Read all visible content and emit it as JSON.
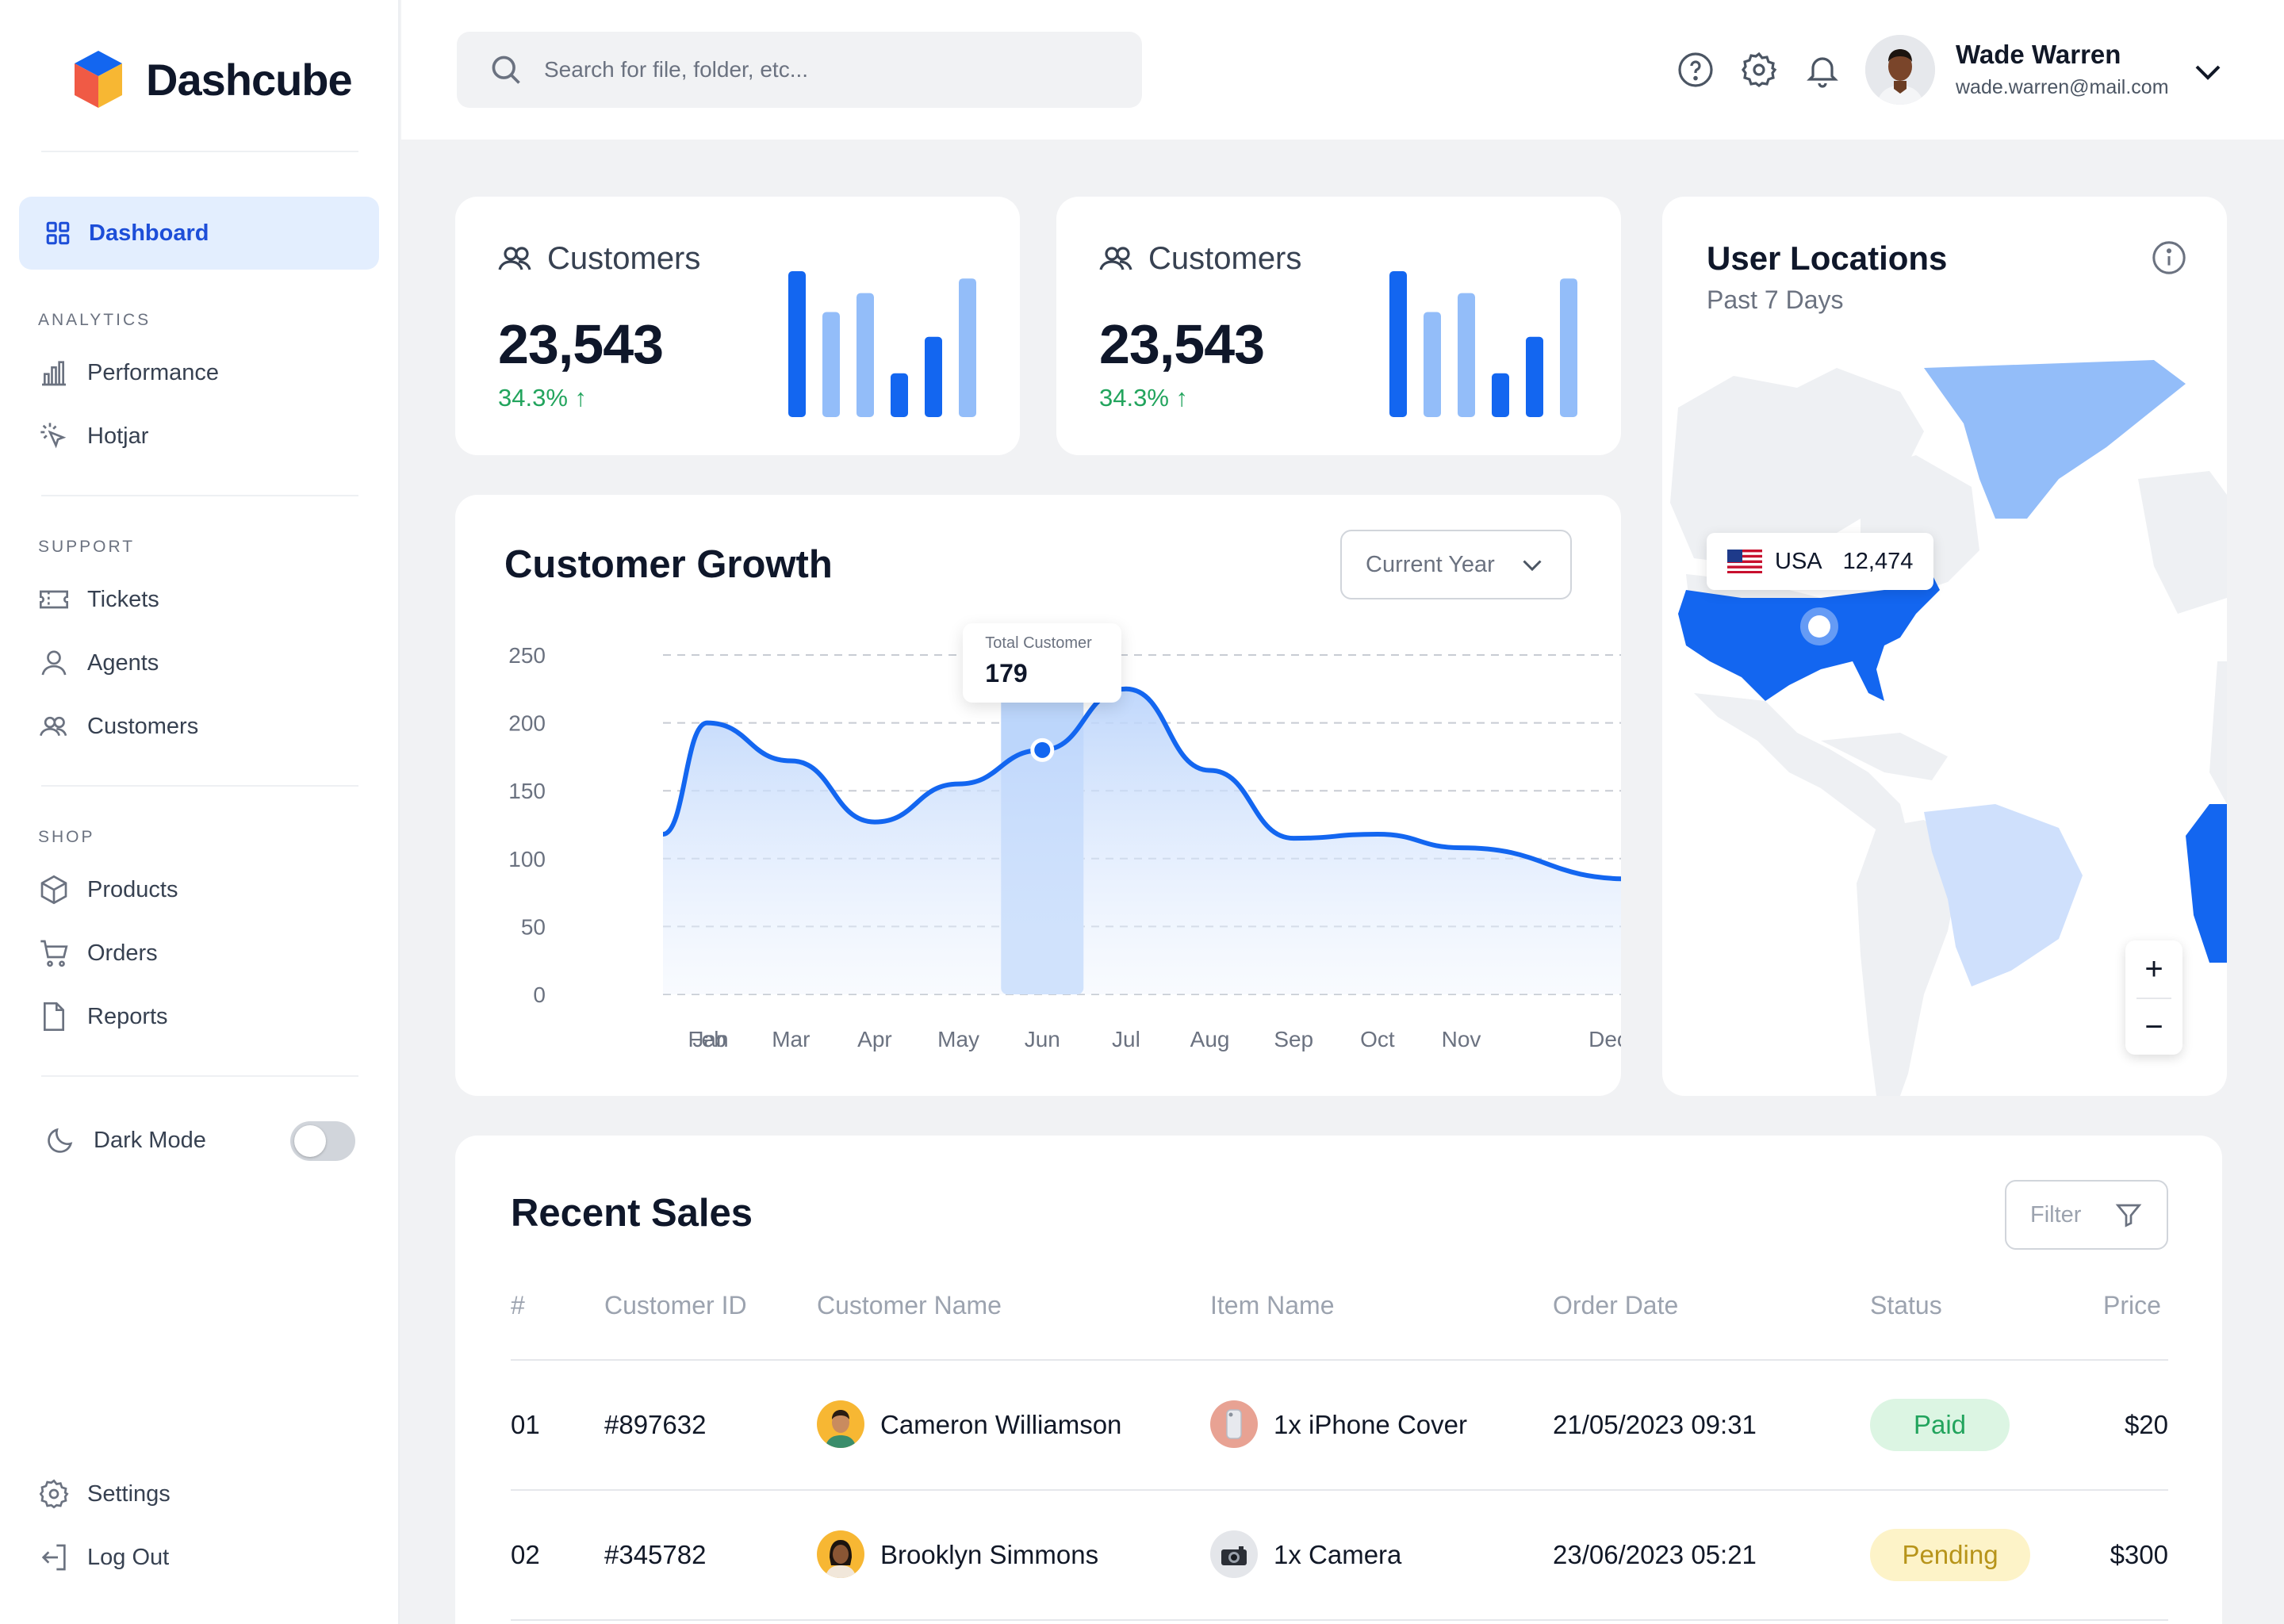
{
  "brand": {
    "name": "Dashcube"
  },
  "sidebar": {
    "active": {
      "label": "Dashboard",
      "icon": "grid-icon"
    },
    "sections": [
      {
        "title": "ANALYTICS",
        "items": [
          {
            "label": "Performance",
            "icon": "bar-chart-icon"
          },
          {
            "label": "Hotjar",
            "icon": "cursor-click-icon"
          }
        ]
      },
      {
        "title": "SUPPORT",
        "items": [
          {
            "label": "Tickets",
            "icon": "ticket-icon"
          },
          {
            "label": "Agents",
            "icon": "user-icon"
          },
          {
            "label": "Customers",
            "icon": "users-icon"
          }
        ]
      },
      {
        "title": "SHOP",
        "items": [
          {
            "label": "Products",
            "icon": "box-icon"
          },
          {
            "label": "Orders",
            "icon": "cart-icon"
          },
          {
            "label": "Reports",
            "icon": "file-icon"
          }
        ]
      }
    ],
    "dark_mode": {
      "label": "Dark Mode",
      "enabled": false
    },
    "bottom": [
      {
        "label": "Settings",
        "icon": "gear-icon"
      },
      {
        "label": "Log Out",
        "icon": "logout-icon"
      }
    ]
  },
  "header": {
    "search_placeholder": "Search for file, folder, etc...",
    "user": {
      "name": "Wade Warren",
      "email": "wade.warren@mail.com"
    }
  },
  "stats": [
    {
      "title": "Customers",
      "value": "23,543",
      "change": "34.3% ↑",
      "bars": [
        100,
        72,
        85,
        30,
        55,
        95
      ]
    },
    {
      "title": "Customers",
      "value": "23,543",
      "change": "34.3% ↑",
      "bars": [
        100,
        72,
        85,
        30,
        55,
        95
      ]
    }
  ],
  "growth": {
    "title": "Customer Growth",
    "period": "Current Year",
    "tooltip": {
      "label": "Total Customer",
      "value": "179"
    }
  },
  "chart_data": {
    "type": "area",
    "title": "Customer Growth",
    "categories": [
      "Jan",
      "Feb",
      "Mar",
      "Apr",
      "May",
      "Jun",
      "Jul",
      "Aug",
      "Sep",
      "Oct",
      "Nov",
      "Dec"
    ],
    "values": [
      118,
      200,
      172,
      127,
      155,
      180,
      225,
      165,
      115,
      118,
      108,
      85
    ],
    "ylim": [
      0,
      250
    ],
    "yticks": [
      0,
      50,
      100,
      150,
      200,
      250
    ],
    "highlight": "Jun",
    "grid": true
  },
  "locations": {
    "title": "User Locations",
    "subtitle": "Past 7 Days",
    "country": "USA",
    "count": "12,474",
    "zoom_in": "+",
    "zoom_out": "−"
  },
  "sales": {
    "title": "Recent Sales",
    "filter_label": "Filter",
    "columns": [
      "#",
      "Customer ID",
      "Customer Name",
      "Item Name",
      "Order Date",
      "Status",
      "Price"
    ],
    "rows": [
      {
        "num": "01",
        "id": "#897632",
        "name": "Cameron Williamson",
        "item": "1x iPhone Cover",
        "date": "21/05/2023 09:31",
        "status": "Paid",
        "price": "$20"
      },
      {
        "num": "02",
        "id": "#345782",
        "name": "Brooklyn Simmons",
        "item": "1x Camera",
        "date": "23/06/2023 05:21",
        "status": "Pending",
        "price": "$300"
      }
    ]
  },
  "colors": {
    "accent": "#1366f0",
    "accent_light": "#93bdf9",
    "paid_bg": "#dcf5e3",
    "paid_text": "#22a45d",
    "pending_bg": "#fdf3c8",
    "pending_text": "#b7941a"
  }
}
